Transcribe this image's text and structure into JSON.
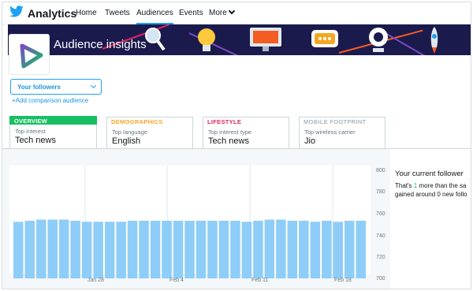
{
  "nav": {
    "brand": "Analytics",
    "items": [
      "Home",
      "Tweets",
      "Audiences",
      "Events",
      "More"
    ],
    "active": "Audiences"
  },
  "banner": {
    "title": "Audience insights"
  },
  "audience": {
    "select_label": "Your followers",
    "add_link": "+Add comparison audience"
  },
  "tabs": [
    {
      "header": "OVERVIEW",
      "sub": "Top interest",
      "value": "Tech news",
      "color": "#17bf63"
    },
    {
      "header": "DEMOGRAPHICS",
      "sub": "Top language",
      "value": "English",
      "color": "#f5a623"
    },
    {
      "header": "LIFESTYLE",
      "sub": "Top interest type",
      "value": "Tech news",
      "color": "#e0245e"
    },
    {
      "header": "MOBILE FOOTPRINT",
      "sub": "Top wireless carrier",
      "value": "Jio",
      "color": "#aab8c2"
    }
  ],
  "summary": {
    "title": "Your current follower",
    "line1_pre": "That's ",
    "line1_num": "1",
    "line1_post": " more than the sa",
    "line2": "gained around 0 new follo"
  },
  "colors": {
    "accent": "#1da1f2",
    "bar": "#8ecdf8",
    "banner_bg": "#1b1a4d"
  },
  "chart_data": {
    "type": "bar",
    "ylim": [
      700,
      800
    ],
    "y_ticks": [
      "800",
      "780",
      "760",
      "740",
      "720",
      "700"
    ],
    "x_ticks": [
      "Jan 28",
      "Feb 4",
      "Feb 11",
      "Feb 18"
    ],
    "values": [
      752,
      753,
      754,
      754,
      754,
      753,
      752,
      752,
      752,
      752,
      753,
      753,
      753,
      753,
      753,
      753,
      753,
      753,
      753,
      753,
      752,
      753,
      754,
      754,
      753,
      753,
      752,
      753,
      752,
      753,
      753
    ]
  }
}
